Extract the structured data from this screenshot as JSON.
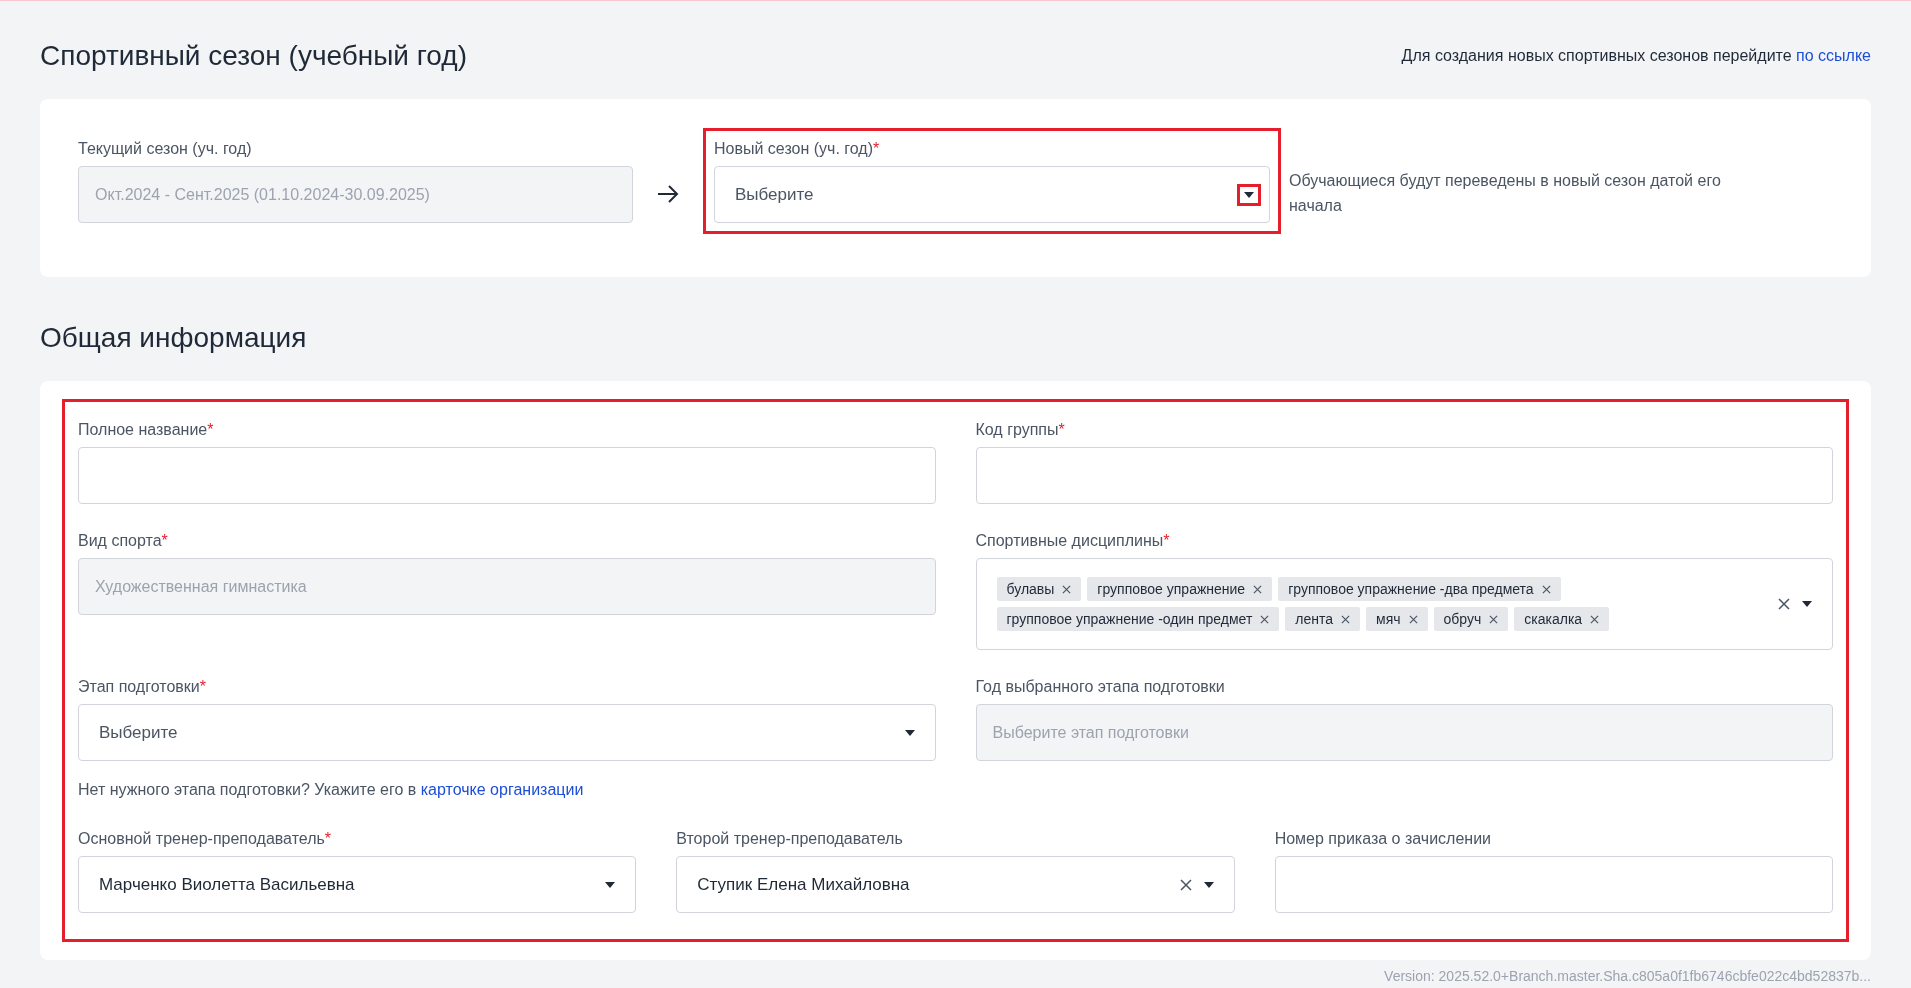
{
  "season": {
    "title": "Спортивный сезон (учебный год)",
    "hint": "Для создания новых спортивных сезонов перейдите",
    "hint_link": "по ссылке",
    "current": {
      "label": "Текущий сезон (уч. год)",
      "value": "Окт.2024 - Сент.2025 (01.10.2024-30.09.2025)"
    },
    "new": {
      "label": "Новый сезон (уч. год)",
      "required_mark": "*",
      "placeholder": "Выберите",
      "highlighted": true,
      "caret_highlighted": true
    },
    "note": "Обучающиеся будут переведены в новый сезон датой его начала"
  },
  "general": {
    "title": "Общая информация",
    "highlighted": true,
    "rows": [
      [
        {
          "kind": "input",
          "label": "Полное название",
          "required_mark": "*"
        },
        {
          "kind": "input",
          "label": "Код группы",
          "required_mark": "*"
        }
      ],
      [
        {
          "kind": "readonly",
          "label": "Вид спорта",
          "required_mark": "*",
          "value": "Художественная гимнастика"
        },
        {
          "kind": "tags",
          "label": "Спортивные дисциплины",
          "required_mark": "*",
          "tags": [
            "булавы",
            "групповое упражнение",
            "групповое упражнение -два предмета",
            "групповое упражнение -один предмет",
            "лента",
            "мяч",
            "обруч",
            "скакалка"
          ],
          "clearable": true
        }
      ],
      [
        {
          "kind": "select",
          "label": "Этап подготовки",
          "required_mark": "*",
          "placeholder": "Выберите",
          "hint": "Нет нужного этапа подготовки? Укажите его в",
          "hint_link": "карточке организации"
        },
        {
          "kind": "readonly",
          "label": "Год выбранного этапа подготовки",
          "placeholder": "Выберите этап подготовки"
        }
      ],
      [
        {
          "kind": "select",
          "label": "Основной тренер-преподаватель",
          "required_mark": "*",
          "value": "Марченко Виолетта Васильевна"
        },
        {
          "kind": "select",
          "label": "Второй тренер-преподаватель",
          "value": "Ступик Елена Михайловна",
          "clearable": true
        },
        {
          "kind": "input",
          "label": "Номер приказа о зачислении"
        }
      ]
    ]
  },
  "version": "Version: 2025.52.0+Branch.master.Sha.c805a0f1fb6746cbfe022c4bd52837b..."
}
